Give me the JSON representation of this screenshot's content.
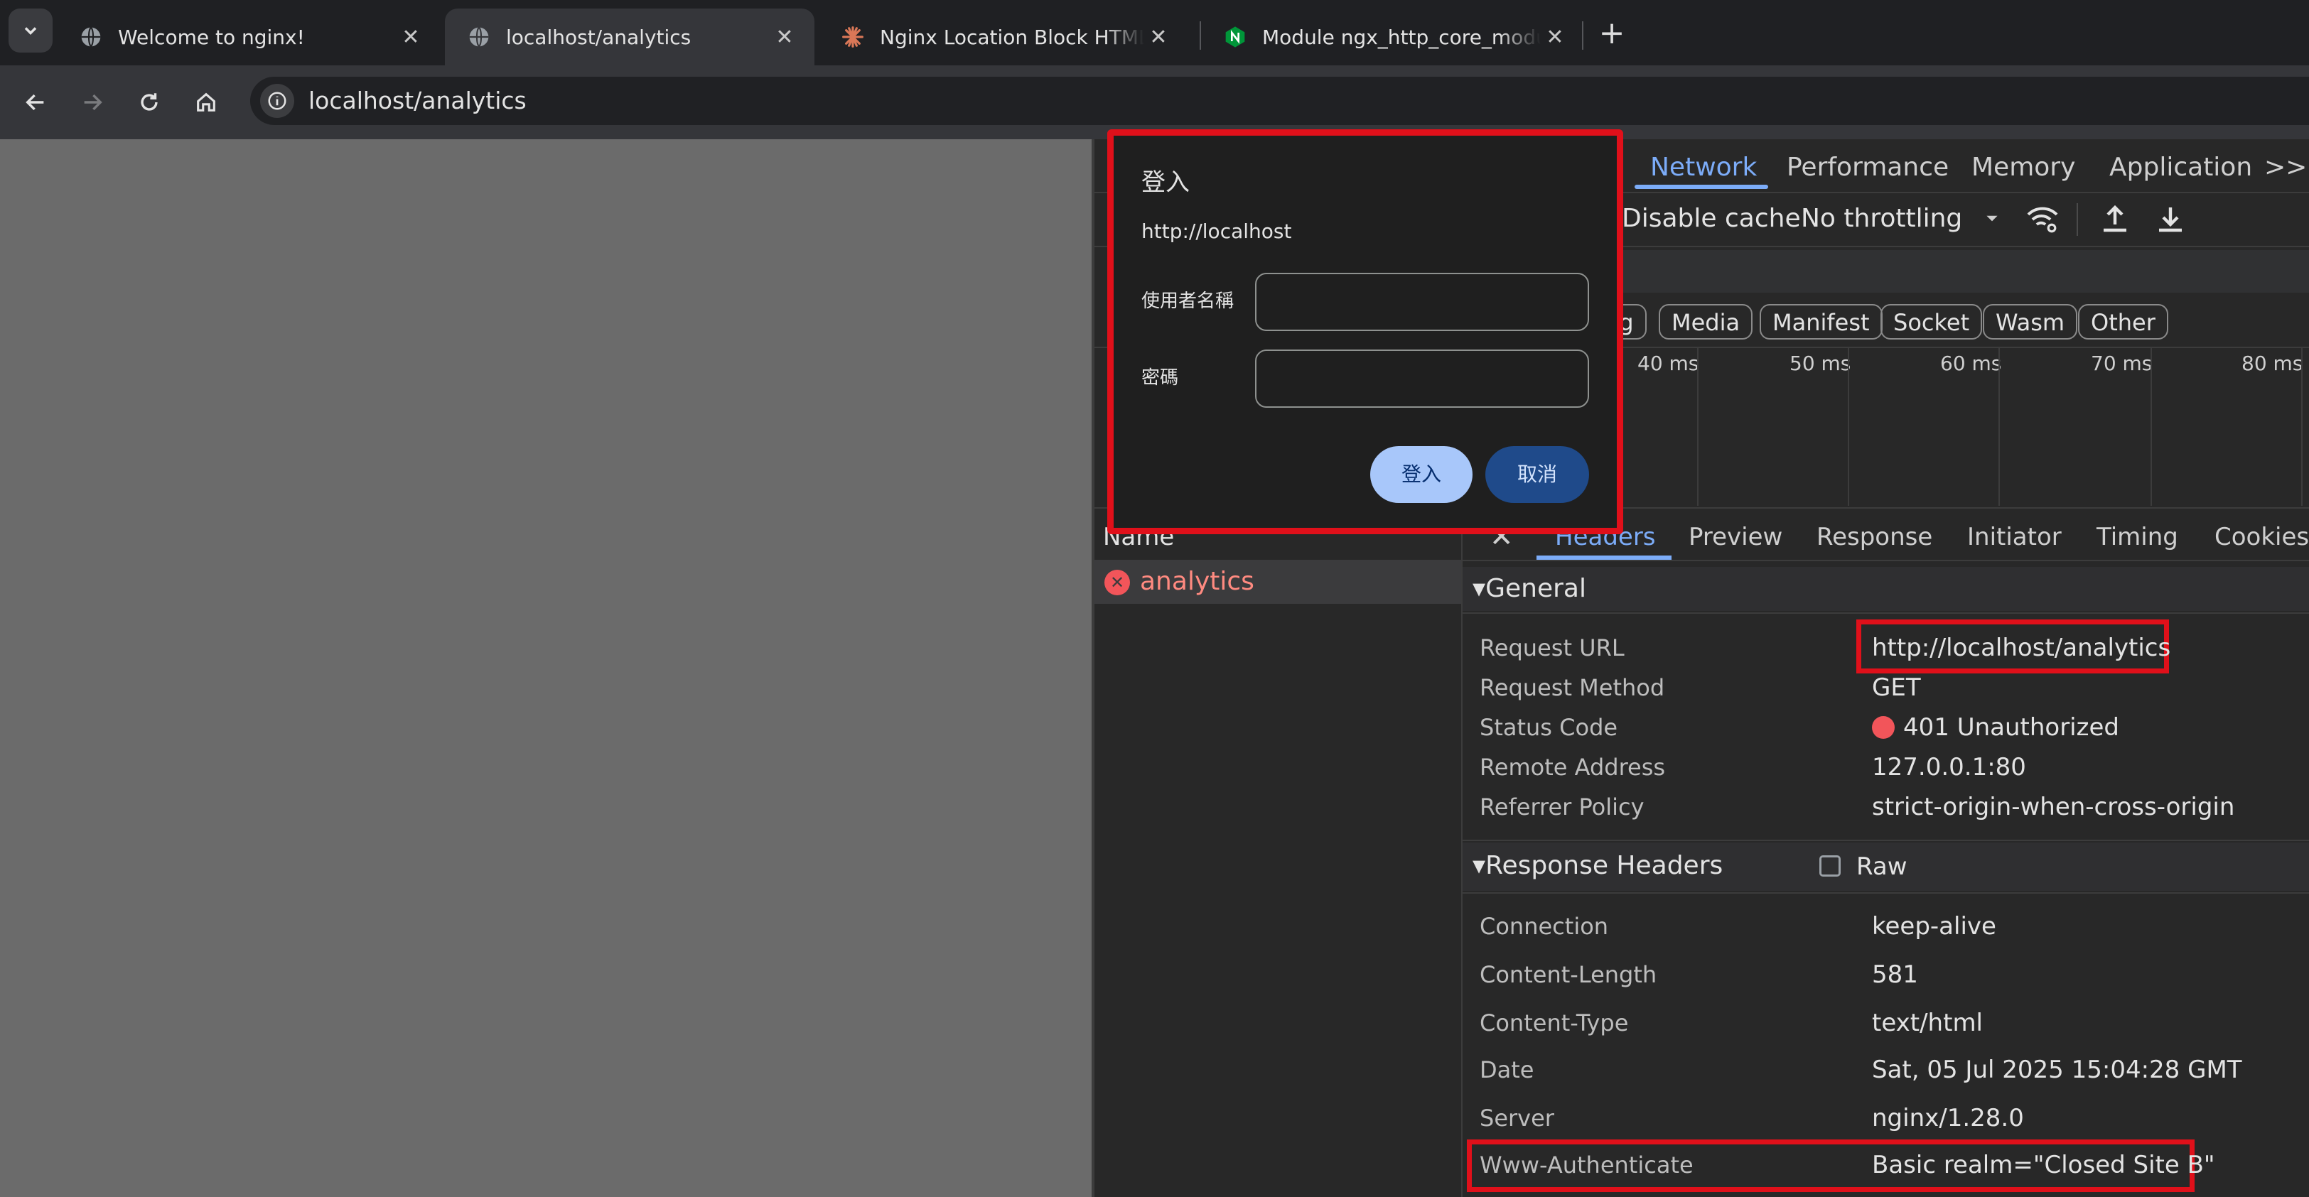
{
  "tabs": [
    {
      "title": "Welcome to nginx!",
      "icon": "globe-icon",
      "active": false
    },
    {
      "title": "localhost/analytics",
      "icon": "globe-icon",
      "active": true
    },
    {
      "title": "Nginx Location Block HTML R",
      "icon": "claude-starburst-icon",
      "active": false
    },
    {
      "title": "Module ngx_http_core_modu",
      "icon": "nginx-logo-icon",
      "active": false
    }
  ],
  "address_bar": {
    "url": "localhost/analytics"
  },
  "devtools": {
    "panel_tabs": [
      "Network",
      "Performance",
      "Memory",
      "Application"
    ],
    "more_tabs": ">>",
    "disable_cache": "Disable cache",
    "throttling": "No throttling",
    "filter_chips": [
      "ng",
      "Media",
      "Manifest",
      "Socket",
      "Wasm",
      "Other"
    ],
    "timeline_ticks": [
      "40 ms",
      "50 ms",
      "60 ms",
      "70 ms",
      "80 ms"
    ],
    "name_column": "Name",
    "request_name": "analytics",
    "detail_tabs": [
      "Headers",
      "Preview",
      "Response",
      "Initiator",
      "Timing",
      "Cookies"
    ],
    "general": {
      "title": "General",
      "rows": [
        {
          "key": "Request URL",
          "value": "http://localhost/analytics"
        },
        {
          "key": "Request Method",
          "value": "GET"
        },
        {
          "key": "Status Code",
          "value": "401 Unauthorized"
        },
        {
          "key": "Remote Address",
          "value": "127.0.0.1:80"
        },
        {
          "key": "Referrer Policy",
          "value": "strict-origin-when-cross-origin"
        }
      ]
    },
    "response_headers": {
      "title": "Response Headers",
      "raw_label": "Raw",
      "rows": [
        {
          "key": "Connection",
          "value": "keep-alive"
        },
        {
          "key": "Content-Length",
          "value": "581"
        },
        {
          "key": "Content-Type",
          "value": "text/html"
        },
        {
          "key": "Date",
          "value": "Sat, 05 Jul 2025 15:04:28 GMT"
        },
        {
          "key": "Server",
          "value": "nginx/1.28.0"
        },
        {
          "key": "Www-Authenticate",
          "value": "Basic realm=\"Closed Site B\""
        }
      ]
    }
  },
  "login_dialog": {
    "title": "登入",
    "origin": "http://localhost",
    "username_label": "使用者名稱",
    "password_label": "密碼",
    "username_value": "",
    "password_value": "",
    "signin_label": "登入",
    "cancel_label": "取消"
  },
  "colors": {
    "highlight": "#e0101a",
    "accent": "#7cacf8",
    "error": "#f2555a",
    "error_text": "#ff8a80"
  }
}
